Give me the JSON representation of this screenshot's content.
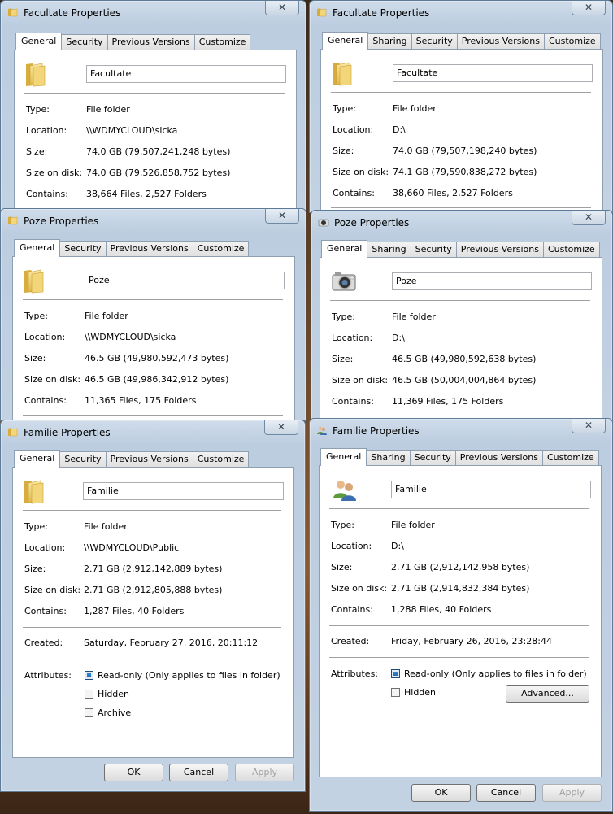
{
  "dialogs": [
    {
      "title": "Facultate Properties",
      "close": "✕",
      "tabs": [
        "General",
        "Security",
        "Previous Versions",
        "Customize"
      ],
      "name": "Facultate",
      "type_label": "Type:",
      "type": "File folder",
      "location_label": "Location:",
      "location": "\\\\WDMYCLOUD\\sicka",
      "size_label": "Size:",
      "size": "74.0 GB (79,507,241,248 bytes)",
      "sod_label": "Size on disk:",
      "size_on_disk": "74.0 GB (79,526,858,752 bytes)",
      "contains_label": "Contains:",
      "contains": "38,664 Files, 2,527 Folders"
    },
    {
      "title": "Facultate Properties",
      "close": "✕",
      "tabs": [
        "General",
        "Sharing",
        "Security",
        "Previous Versions",
        "Customize"
      ],
      "name": "Facultate",
      "type_label": "Type:",
      "type": "File folder",
      "location_label": "Location:",
      "location": "D:\\",
      "size_label": "Size:",
      "size": "74.0 GB (79,507,198,240 bytes)",
      "sod_label": "Size on disk:",
      "size_on_disk": "74.1 GB (79,590,838,272 bytes)",
      "contains_label": "Contains:",
      "contains": "38,660 Files, 2,527 Folders"
    },
    {
      "title": "Poze Properties",
      "close": "✕",
      "tabs": [
        "General",
        "Security",
        "Previous Versions",
        "Customize"
      ],
      "name": "Poze",
      "type_label": "Type:",
      "type": "File folder",
      "location_label": "Location:",
      "location": "\\\\WDMYCLOUD\\sicka",
      "size_label": "Size:",
      "size": "46.5 GB (49,980,592,473 bytes)",
      "sod_label": "Size on disk:",
      "size_on_disk": "46.5 GB (49,986,342,912 bytes)",
      "contains_label": "Contains:",
      "contains": "11,365 Files, 175 Folders"
    },
    {
      "title": "Poze Properties",
      "close": "✕",
      "tabs": [
        "General",
        "Sharing",
        "Security",
        "Previous Versions",
        "Customize"
      ],
      "name": "Poze",
      "type_label": "Type:",
      "type": "File folder",
      "location_label": "Location:",
      "location": "D:\\",
      "size_label": "Size:",
      "size": "46.5 GB (49,980,592,638 bytes)",
      "sod_label": "Size on disk:",
      "size_on_disk": "46.5 GB (50,004,004,864 bytes)",
      "contains_label": "Contains:",
      "contains": "11,369 Files, 175 Folders"
    },
    {
      "title": "Familie Properties",
      "close": "✕",
      "tabs": [
        "General",
        "Security",
        "Previous Versions",
        "Customize"
      ],
      "name": "Familie",
      "type_label": "Type:",
      "type": "File folder",
      "location_label": "Location:",
      "location": "\\\\WDMYCLOUD\\Public",
      "size_label": "Size:",
      "size": "2.71 GB (2,912,142,889 bytes)",
      "sod_label": "Size on disk:",
      "size_on_disk": "2.71 GB (2,912,805,888 bytes)",
      "contains_label": "Contains:",
      "contains": "1,287 Files, 40 Folders",
      "created_label": "Created:",
      "created": "Saturday, February 27, 2016, 20:11:12",
      "attributes_label": "Attributes:",
      "readonly": "Read-only (Only applies to files in folder)",
      "hidden": "Hidden",
      "archive": "Archive",
      "ok": "OK",
      "cancel": "Cancel",
      "apply": "Apply"
    },
    {
      "title": "Familie Properties",
      "close": "✕",
      "tabs": [
        "General",
        "Sharing",
        "Security",
        "Previous Versions",
        "Customize"
      ],
      "name": "Familie",
      "type_label": "Type:",
      "type": "File folder",
      "location_label": "Location:",
      "location": "D:\\",
      "size_label": "Size:",
      "size": "2.71 GB (2,912,142,958 bytes)",
      "sod_label": "Size on disk:",
      "size_on_disk": "2.71 GB (2,914,832,384 bytes)",
      "contains_label": "Contains:",
      "contains": "1,288 Files, 40 Folders",
      "created_label": "Created:",
      "created": "Friday, February 26, 2016, 23:28:44",
      "attributes_label": "Attributes:",
      "readonly": "Read-only (Only applies to files in folder)",
      "hidden": "Hidden",
      "advanced": "Advanced...",
      "ok": "OK",
      "cancel": "Cancel",
      "apply": "Apply"
    }
  ],
  "colors": {
    "frame": "#c2d2e3",
    "panel": "#ffffff",
    "checkbox_on": "#1a5fa8"
  }
}
